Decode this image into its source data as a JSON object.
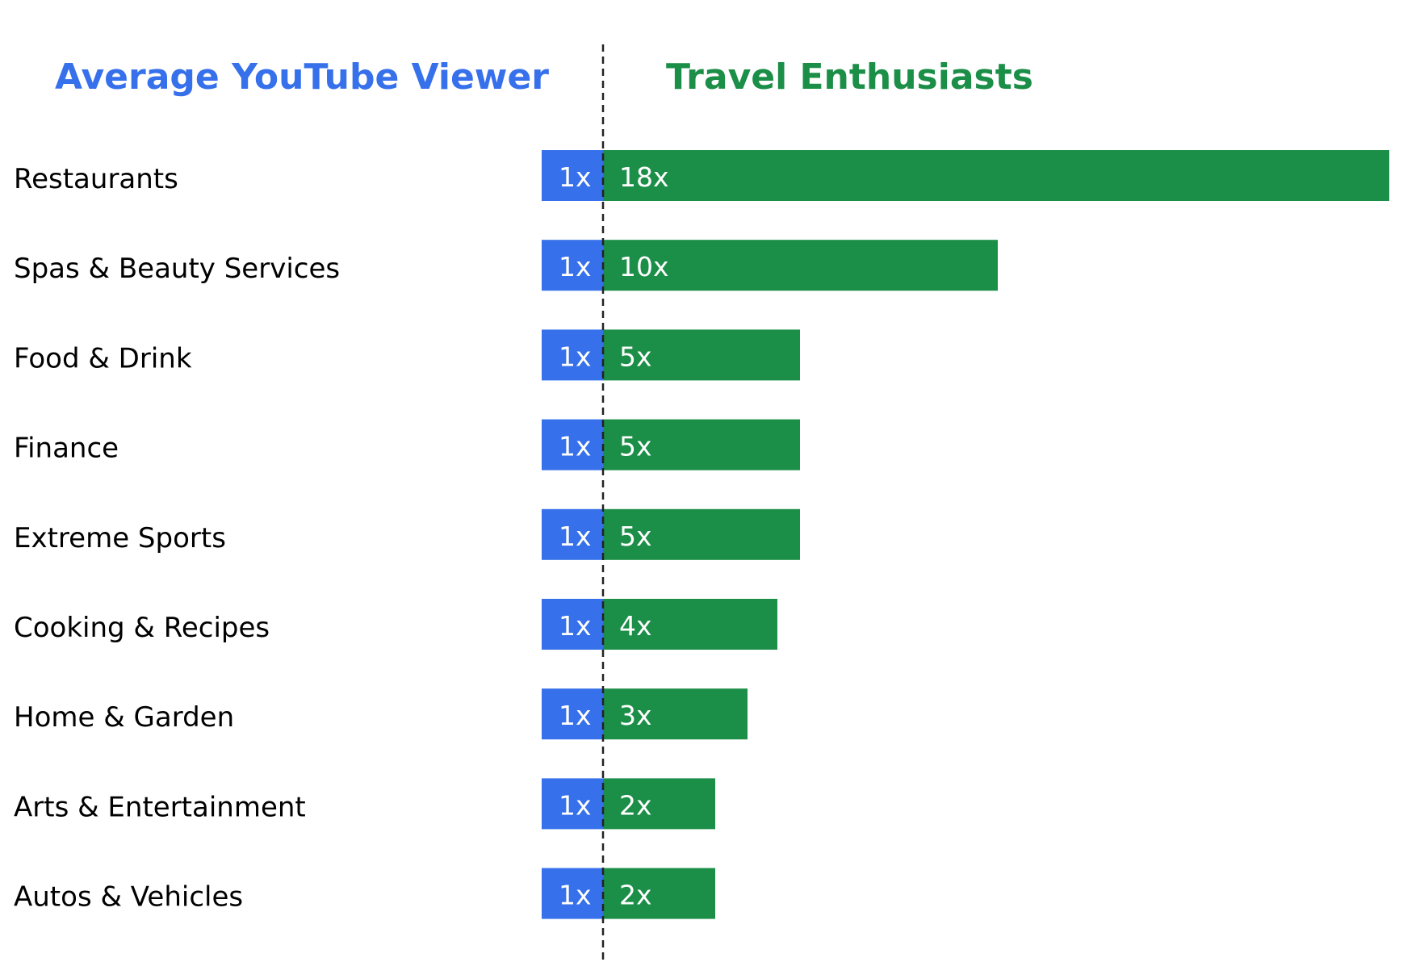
{
  "chart_data": {
    "type": "bar",
    "orientation": "horizontal",
    "title": "",
    "xlabel": "",
    "ylabel": "",
    "grid": false,
    "legend": "none",
    "series_headers": [
      {
        "name": "Average YouTube Viewer",
        "color": "#3670EB"
      },
      {
        "name": "Travel Enthusiasts",
        "color": "#1B8E47"
      }
    ],
    "categories": [
      "Restaurants",
      "Spas & Beauty Services",
      "Food & Drink",
      "Finance",
      "Extreme Sports",
      "Cooking & Recipes",
      "Home & Garden",
      "Arts & Entertainment",
      "Autos & Vehicles"
    ],
    "series": [
      {
        "name": "Average YouTube Viewer",
        "values": [
          1,
          1,
          1,
          1,
          1,
          1,
          1,
          1,
          1
        ],
        "labels": [
          "1x",
          "1x",
          "1x",
          "1x",
          "1x",
          "1x",
          "1x",
          "1x",
          "1x"
        ]
      },
      {
        "name": "Travel Enthusiasts",
        "values": [
          18,
          10,
          5,
          5,
          5,
          4,
          3,
          2,
          2
        ],
        "labels": [
          "18x",
          "10x",
          "5x",
          "5x",
          "5x",
          "4x",
          "3x",
          "2x",
          "2x"
        ]
      }
    ],
    "baseline_label": "dashed divider at 1x"
  }
}
